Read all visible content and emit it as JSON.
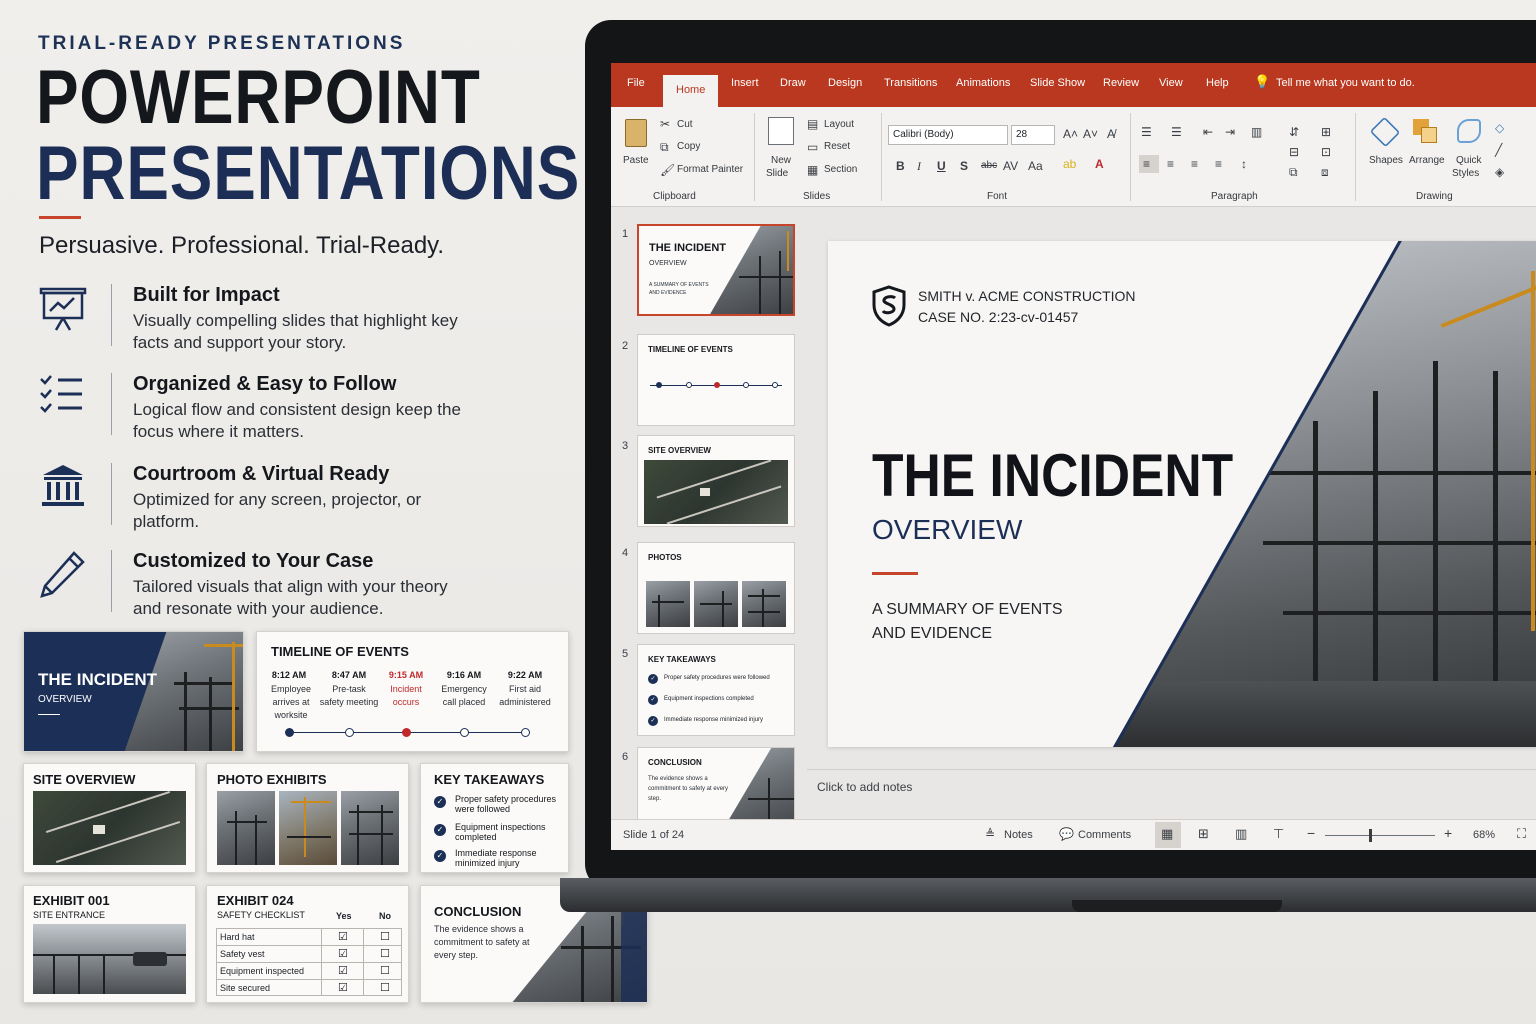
{
  "hero": {
    "eyebrow": "TRIAL-READY PRESENTATIONS",
    "title_line1": "POWERPOINT",
    "title_line2": "PRESENTATIONS",
    "tagline": "Persuasive. Professional. Trial-Ready."
  },
  "features": [
    {
      "title": "Built for Impact",
      "text": "Visually compelling slides that highlight key facts and support your story.",
      "icon": "presentation-board-icon"
    },
    {
      "title": "Organized & Easy to Follow",
      "text": "Logical flow and consistent design keep the focus where it matters.",
      "icon": "checklist-icon"
    },
    {
      "title": "Courtroom & Virtual Ready",
      "text": "Optimized for any screen, projector, or platform.",
      "icon": "courthouse-icon"
    },
    {
      "title": "Customized to Your Case",
      "text": "Tailored visuals that align with your theory and resonate with your audience.",
      "icon": "pencil-icon"
    }
  ],
  "cards": {
    "incident": {
      "title": "THE INCIDENT",
      "subtitle": "OVERVIEW"
    },
    "timeline": {
      "title": "TIMELINE OF EVENTS",
      "events": [
        {
          "time": "8:12 AM",
          "text": "Employee arrives at worksite",
          "highlight": false
        },
        {
          "time": "8:47 AM",
          "text": "Pre-task safety meeting",
          "highlight": false
        },
        {
          "time": "9:15 AM",
          "text": "Incident occurs",
          "highlight": true
        },
        {
          "time": "9:16 AM",
          "text": "Emergency call placed",
          "highlight": false
        },
        {
          "time": "9:22 AM",
          "text": "First aid administered",
          "highlight": false
        }
      ]
    },
    "site": {
      "title": "SITE OVERVIEW"
    },
    "photos": {
      "title": "PHOTO EXHIBITS"
    },
    "takeaways": {
      "title": "KEY TAKEAWAYS",
      "items": [
        "Proper safety procedures were followed",
        "Equipment inspections completed",
        "Immediate response minimized injury"
      ]
    },
    "exhibit001": {
      "title": "EXHIBIT 001",
      "subtitle": "SITE ENTRANCE"
    },
    "exhibit024": {
      "title": "EXHIBIT 024",
      "subtitle": "SAFETY CHECKLIST",
      "col_yes": "Yes",
      "col_no": "No",
      "rows": [
        "Hard hat",
        "Safety vest",
        "Equipment inspected",
        "Site secured"
      ]
    },
    "conclusion": {
      "title": "CONCLUSION",
      "text": "The evidence shows a commitment to safety at every step."
    }
  },
  "ppt": {
    "tabs": [
      "File",
      "Home",
      "Insert",
      "Draw",
      "Design",
      "Transitions",
      "Animations",
      "Slide Show",
      "Review",
      "View",
      "Help"
    ],
    "active_tab": "Home",
    "tell_me": "Tell me what you want to do.",
    "clipboard": {
      "paste": "Paste",
      "cut": "Cut",
      "copy": "Copy",
      "format_painter": "Format Painter",
      "label": "Clipboard"
    },
    "slides": {
      "new_slide_1": "New",
      "new_slide_2": "Slide",
      "layout": "Layout",
      "reset": "Reset",
      "section": "Section",
      "label": "Slides"
    },
    "font": {
      "family": "Calibri (Body)",
      "size": "28",
      "label": "Font"
    },
    "paragraph": {
      "label": "Paragraph"
    },
    "drawing": {
      "shapes": "Shapes",
      "arrange": "Arrange",
      "quick_styles_1": "Quick",
      "quick_styles_2": "Styles",
      "label": "Drawing"
    },
    "thumbnails": [
      {
        "n": "1",
        "title": "THE INCIDENT",
        "sub": "OVERVIEW",
        "sub2": "A SUMMARY OF EVENTS AND EVIDENCE"
      },
      {
        "n": "2",
        "title": "TIMELINE OF EVENTS"
      },
      {
        "n": "3",
        "title": "SITE OVERVIEW"
      },
      {
        "n": "4",
        "title": "PHOTOS"
      },
      {
        "n": "5",
        "title": "KEY TAKEAWAYS",
        "items": [
          "Proper safety procedures were followed",
          "Equipment inspections completed",
          "Immediate response minimized injury"
        ]
      },
      {
        "n": "6",
        "title": "CONCLUSION",
        "text": "The evidence shows a commitment to safety at every step."
      }
    ],
    "slide": {
      "case_line1": "SMITH v. ACME CONSTRUCTION",
      "case_line2": "CASE NO. 2:23-cv-01457",
      "title": "THE INCIDENT",
      "subtitle": "OVERVIEW",
      "summary_line1": "A SUMMARY OF EVENTS",
      "summary_line2": "AND EVIDENCE"
    },
    "notes_placeholder": "Click to add notes",
    "status": {
      "slide_count": "Slide 1 of 24",
      "notes": "Notes",
      "comments": "Comments",
      "zoom": "68%"
    }
  },
  "colors": {
    "navy": "#1c2f56",
    "accent": "#c7452a",
    "ribbon": "#b9381f"
  }
}
